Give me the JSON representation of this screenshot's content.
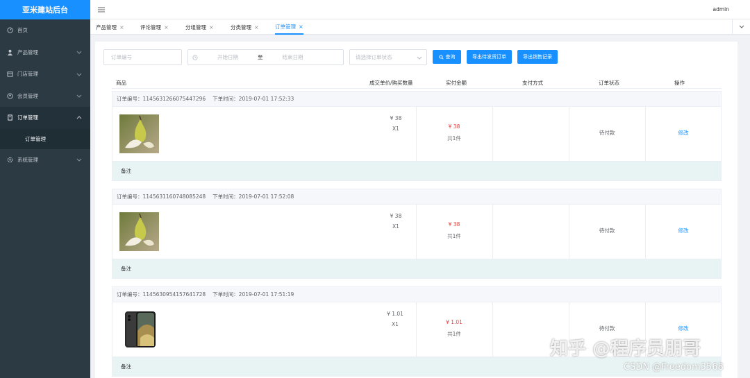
{
  "brand": "亚米建站后台",
  "header": {
    "user": "admin"
  },
  "sidebar": {
    "items": [
      {
        "label": "首页",
        "icon": "dashboard-icon",
        "arrow": false
      },
      {
        "label": "产品管理",
        "icon": "user-icon",
        "arrow": true
      },
      {
        "label": "门店管理",
        "icon": "store-icon",
        "arrow": true
      },
      {
        "label": "会员管理",
        "icon": "member-icon",
        "arrow": true
      },
      {
        "label": "订单管理",
        "icon": "order-icon",
        "arrow": true
      },
      {
        "label": "系统管理",
        "icon": "settings-icon",
        "arrow": true
      }
    ],
    "submenu": "订单管理"
  },
  "tabs": [
    "产品管理",
    "评论管理",
    "分组管理",
    "分类管理",
    "订单管理"
  ],
  "filters": {
    "order_no_placeholder": "订单编号",
    "start_date_placeholder": "开始日期",
    "date_sep": "至",
    "end_date_placeholder": "结束日期",
    "status_placeholder": "请选择订单状态"
  },
  "buttons": {
    "search": "查询",
    "export_pending": "导出待发货订单",
    "export_sales": "导出销售记录"
  },
  "table_headers": [
    "商品",
    "成交单价/购买数量",
    "实付金额",
    "支付方式",
    "订单状态",
    "操作"
  ],
  "labels": {
    "order_no": "订单编号：",
    "order_time": "下单时间：",
    "remark": "备注",
    "edit": "修改"
  },
  "orders": [
    {
      "no": "1145631266075447296",
      "time": "2019-07-01 17:52:33",
      "unit_price": "¥ 38",
      "qty": "X1",
      "paid": "¥ 38",
      "count": "共1件",
      "status": "待付款",
      "image": "pear"
    },
    {
      "no": "1145631160748085248",
      "time": "2019-07-01 17:52:08",
      "unit_price": "¥ 38",
      "qty": "X1",
      "paid": "¥ 38",
      "count": "共1件",
      "status": "待付款",
      "image": "pear"
    },
    {
      "no": "1145630954157641728",
      "time": "2019-07-01 17:51:19",
      "unit_price": "¥ 1.01",
      "qty": "X1",
      "paid": "¥ 1.01",
      "count": "共1件",
      "status": "待付款",
      "image": "phone"
    }
  ],
  "watermark": {
    "zhihu": "知乎 @程序员朋哥",
    "csdn": "CSDN @Freedom3568"
  },
  "colors": {
    "accent": "#1890ff",
    "sidebar": "#2b3a43",
    "price_red": "#e6403c",
    "remark_bg": "#e8f4f4"
  }
}
